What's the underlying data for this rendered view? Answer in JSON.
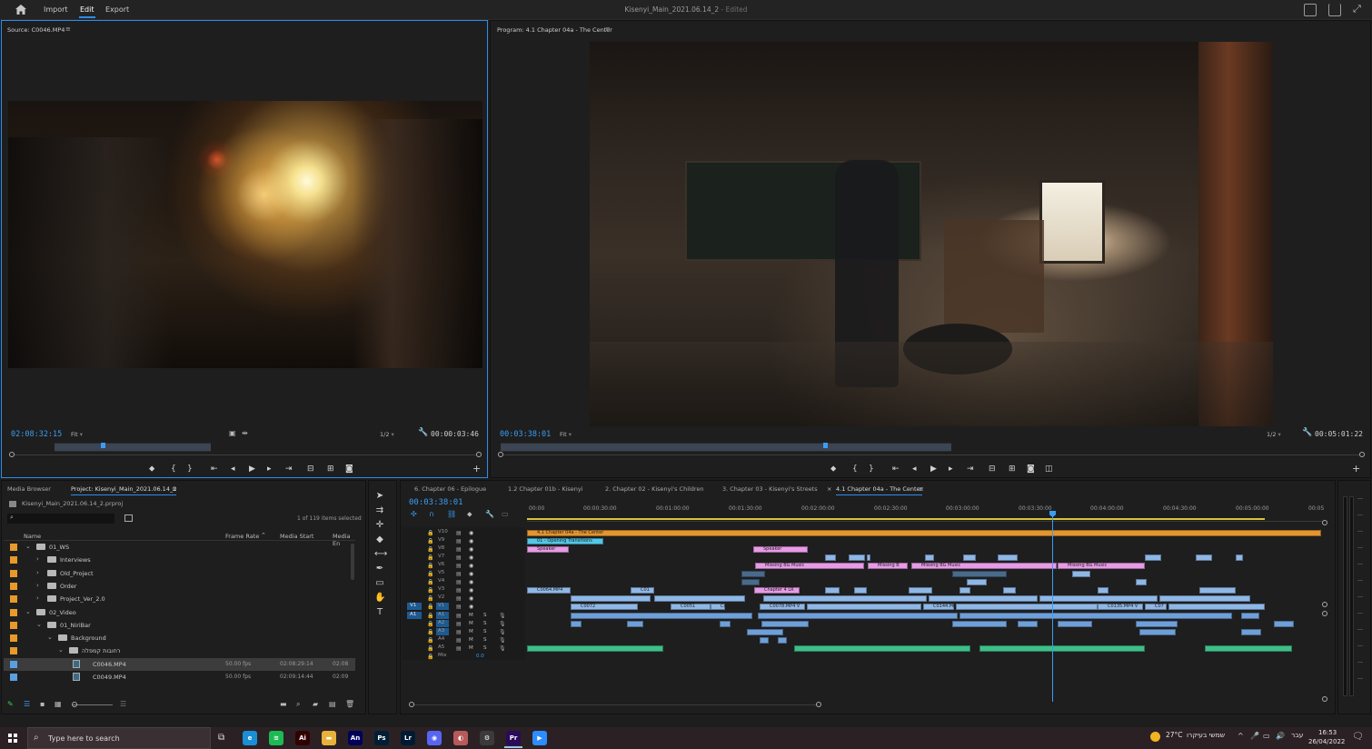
{
  "topbar": {
    "menus": [
      "Import",
      "Edit",
      "Export"
    ],
    "active_menu": "Edit",
    "title": "Kisenyi_Main_2021.06.14_2",
    "title_suffix": "- Edited"
  },
  "source_monitor": {
    "title": "Source: C0046.MP4",
    "timecode": "02:08:32:15",
    "fit": "Fit",
    "resolution": "1/2",
    "duration": "00:00:03:46",
    "playhead_fraction": 0.31
  },
  "program_monitor": {
    "title": "Program: 4.1 Chapter 04a - The Center",
    "timecode": "00:03:38:01",
    "fit": "Fit",
    "resolution": "1/2",
    "duration": "00:05:01:22",
    "playhead_fraction": 0.72
  },
  "project_panel": {
    "tabs": [
      "Media Browser",
      "Project: Kisenyi_Main_2021.06.14_2"
    ],
    "active_tab": "Project: Kisenyi_Main_2021.06.14_2",
    "project_file": "Kisenyi_Main_2021.06.14_2.prproj",
    "selection_count": "1 of 119 items selected",
    "columns": [
      "Name",
      "Frame Rate",
      "Media Start",
      "Media En"
    ],
    "rows": [
      {
        "name": "01_WS",
        "color": "#e8992a",
        "indent": 0,
        "open": true,
        "type": "bin"
      },
      {
        "name": "Interviews",
        "color": "#e8992a",
        "indent": 1,
        "open": false,
        "type": "bin"
      },
      {
        "name": "Old_Project",
        "color": "#e8992a",
        "indent": 1,
        "open": false,
        "type": "bin"
      },
      {
        "name": "Order",
        "color": "#e8992a",
        "indent": 1,
        "open": false,
        "type": "bin"
      },
      {
        "name": "Project_Ver_2.0",
        "color": "#e8992a",
        "indent": 1,
        "open": false,
        "type": "bin"
      },
      {
        "name": "02_Video",
        "color": "#e8992a",
        "indent": 0,
        "open": true,
        "type": "bin"
      },
      {
        "name": "01_NiriBar",
        "color": "#e8992a",
        "indent": 1,
        "open": true,
        "type": "bin"
      },
      {
        "name": "Background",
        "color": "#e8992a",
        "indent": 2,
        "open": true,
        "type": "bin"
      },
      {
        "name": "רחובות קמפלה",
        "color": "#e8992a",
        "indent": 3,
        "open": true,
        "type": "bin"
      },
      {
        "name": "C0046.MP4",
        "color": "#5aa0e0",
        "indent": 4,
        "type": "clip",
        "frame_rate": "50.00 fps",
        "media_start": "02:08:29:14",
        "media_end": "02:08",
        "selected": true
      },
      {
        "name": "C0049.MP4",
        "color": "#5aa0e0",
        "indent": 4,
        "type": "clip",
        "frame_rate": "50.00 fps",
        "media_start": "02:09:14:44",
        "media_end": "02:09"
      }
    ]
  },
  "timeline": {
    "tabs": [
      "6. Chapter 06 - Epilogue",
      "1.2 Chapter 01b - Kisenyi",
      "2. Chapter 02 - Kisenyi's Children",
      "3. Chapter 03 - Kisenyi's Streets",
      "4.1 Chapter 04a - The Center"
    ],
    "active_tab": "4.1 Chapter 04a - The Center",
    "timecode": "00:03:38:01",
    "ruler": [
      "00:00",
      "00:00:30:00",
      "00:01:00:00",
      "00:01:30:00",
      "00:02:00:00",
      "00:02:30:00",
      "00:03:00:00",
      "00:03:30:00",
      "00:04:00:00",
      "00:04:30:00",
      "00:05:00:00",
      "00:05"
    ],
    "tracks": [
      "V10",
      "V9",
      "V8",
      "V7",
      "V6",
      "V5",
      "V4",
      "V3",
      "V2",
      "V1",
      "A1",
      "A2",
      "A3",
      "A4",
      "A5",
      "Mix"
    ],
    "source_patch": {
      "video": "V1",
      "audio": "A1"
    },
    "track_buttons": [
      "M",
      "S"
    ],
    "mix_value": "0.0",
    "clip_labels": {
      "adjustment": "4.1 Chapter 04a - The Center",
      "opening": "01 - Opening Transitions",
      "speaker1": "Speaker",
      "speaker2": "Speaker",
      "bg1": "Missing BG Music",
      "bg2": "Missing B",
      "bg3": "Missing BG Music",
      "bg4": "Missing BG Music",
      "v3a": "C0064.MP4",
      "v3b": "C01",
      "v3c": "Chapter 4 LR",
      "v1a": "C0072",
      "v1b": "C0051",
      "v1c": "C00",
      "v1d": "C0078.MP4 V",
      "v1e": "C0144.MP4",
      "v1f": "C0135.MP4 V",
      "v1g": "C07"
    }
  },
  "taskbar": {
    "search_placeholder": "Type here to search",
    "weather": "27°C",
    "weather_text": "שמשי בעיקרו",
    "language": "עבר",
    "time": "16:53",
    "date": "26/04/2022",
    "apps": [
      {
        "name": "edge",
        "color": "#1b8fd6",
        "glyph": "e"
      },
      {
        "name": "spotify",
        "color": "#1db954",
        "glyph": "≋"
      },
      {
        "name": "illustrator",
        "color": "#330000",
        "glyph": "Ai"
      },
      {
        "name": "file-explorer",
        "color": "#e8b23a",
        "glyph": "▬"
      },
      {
        "name": "animate",
        "color": "#00005b",
        "glyph": "An"
      },
      {
        "name": "photoshop",
        "color": "#001e36",
        "glyph": "Ps"
      },
      {
        "name": "lightroom",
        "color": "#001a33",
        "glyph": "Lr"
      },
      {
        "name": "discord",
        "color": "#5865f2",
        "glyph": "◉"
      },
      {
        "name": "chrome-like",
        "color": "#b85a5a",
        "glyph": "◐"
      },
      {
        "name": "settings",
        "color": "#3a3a3a",
        "glyph": "⚙"
      },
      {
        "name": "premiere",
        "color": "#2a0a5a",
        "glyph": "Pr"
      },
      {
        "name": "zoom",
        "color": "#2d8cff",
        "glyph": "▶"
      }
    ]
  }
}
